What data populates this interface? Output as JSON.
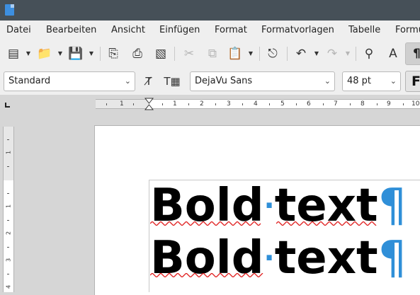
{
  "menu": {
    "items": [
      "Datei",
      "Bearbeiten",
      "Ansicht",
      "Einfügen",
      "Format",
      "Formatvorlagen",
      "Tabelle",
      "Formu"
    ]
  },
  "format_bar": {
    "paragraph_style": "Standard",
    "font_name": "DejaVu Sans",
    "font_size": "48 pt",
    "bold_label": "F"
  },
  "ruler": {
    "horizontal_numbers": [
      "1",
      "1",
      "2",
      "3",
      "4",
      "5",
      "6",
      "7",
      "8",
      "9",
      "10"
    ],
    "vertical_numbers": [
      "1",
      "1",
      "2",
      "3",
      "4"
    ]
  },
  "document": {
    "lines": [
      {
        "word1": "Bold",
        "space_mark": "·",
        "word2": "text",
        "paragraph_mark": "¶"
      },
      {
        "word1": "Bold",
        "space_mark": "·",
        "word2": "text",
        "paragraph_mark": "¶"
      }
    ]
  },
  "colors": {
    "titlebar": "#465058",
    "formatting_marks": "#2f8fd8",
    "spellcheck": "#e02020"
  }
}
